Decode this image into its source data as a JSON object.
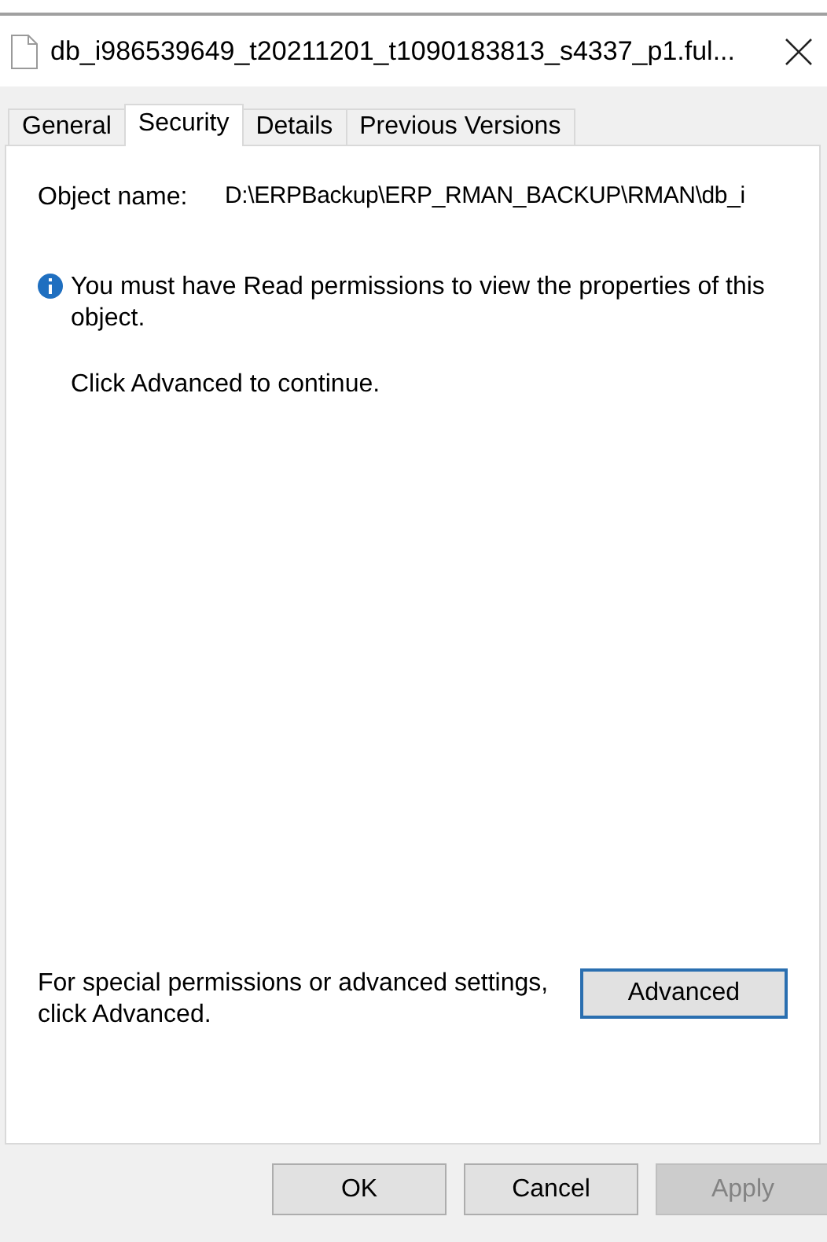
{
  "window": {
    "title": "db_i986539649_t20211201_t1090183813_s4337_p1.ful..."
  },
  "tabs": [
    {
      "label": "General",
      "selected": false
    },
    {
      "label": "Security",
      "selected": true
    },
    {
      "label": "Details",
      "selected": false
    },
    {
      "label": "Previous Versions",
      "selected": false
    }
  ],
  "object_name": {
    "label": "Object name:",
    "value": "D:\\ERPBackup\\ERP_RMAN_BACKUP\\RMAN\\db_i"
  },
  "message": "You must have Read permissions to view the properties of this object.",
  "hint": "Click Advanced to continue.",
  "advanced": {
    "text": "For special permissions or advanced settings, click Advanced.",
    "button": {
      "label": "Advanced",
      "focused": true
    }
  },
  "buttons": [
    {
      "label": "OK",
      "disabled": false
    },
    {
      "label": "Cancel",
      "disabled": false
    },
    {
      "label": "Apply",
      "disabled": true
    }
  ]
}
